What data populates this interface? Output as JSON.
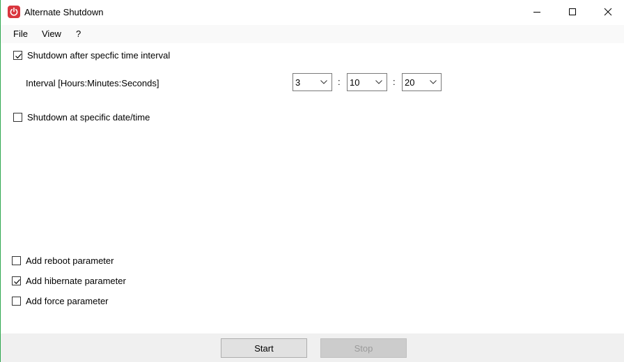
{
  "window": {
    "title": "Alternate Shutdown"
  },
  "menu": {
    "file": "File",
    "view": "View",
    "help": "?"
  },
  "interval_option": {
    "label": "Shutdown after specfic time interval",
    "checked": true,
    "interval_label": "Interval [Hours:Minutes:Seconds]",
    "hours": "3",
    "minutes": "10",
    "seconds": "20",
    "separator": ":"
  },
  "datetime_option": {
    "label": "Shutdown at specific date/time",
    "checked": false
  },
  "parameters": [
    {
      "label": "Add reboot parameter",
      "checked": false
    },
    {
      "label": "Add hibernate parameter",
      "checked": true
    },
    {
      "label": "Add force parameter",
      "checked": false
    }
  ],
  "buttons": {
    "start": "Start",
    "stop": "Stop"
  },
  "colors": {
    "app_icon": "#d9363e",
    "accent_border": "#2fa84f"
  }
}
